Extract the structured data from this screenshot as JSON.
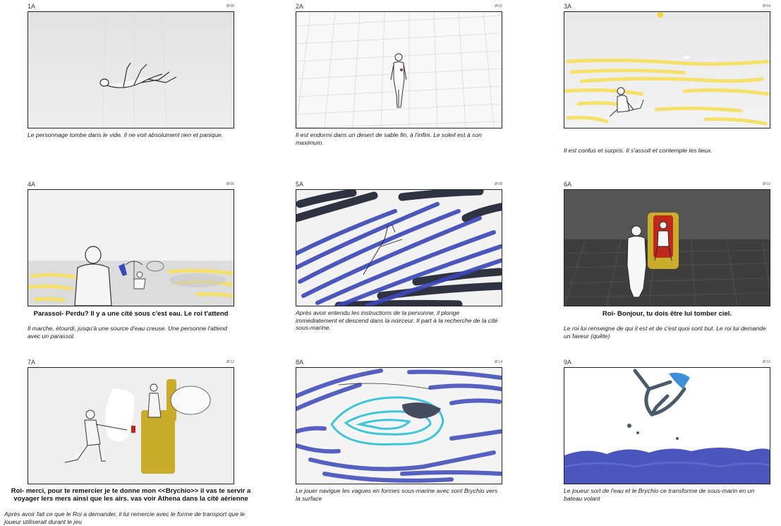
{
  "panels": [
    {
      "id": "1A",
      "time": "Ø:08",
      "dialogue": "",
      "caption": "Le personnage tombe dans le vide. Il ne voit absolument rien et panique."
    },
    {
      "id": "2A",
      "time": "Ø:02",
      "dialogue": "",
      "caption": "Il est endormi dans un desert de sable fin, à l'infini. Le soleil est à son maximum."
    },
    {
      "id": "3A",
      "time": "Ø:04",
      "dialogue": "",
      "caption": "Il est confus et surpris. Il s'assoit et contemple les lieux."
    },
    {
      "id": "4A",
      "time": "Ø:06",
      "dialogue": "Parassol- Perdu? Il y a une cité sous c'est eau. Le roi t'attend",
      "caption": "Il marche, étourdi, jusqu'à une source d'eau creuse. Une personne l'attend avec un parassol."
    },
    {
      "id": "5A",
      "time": "Ø:08",
      "dialogue": "",
      "caption": "Après avoir entendu les instructions de la personne, il plonge immédiatement et descend dans la noirceur. Il part à la recherche de la cité sous-marine."
    },
    {
      "id": "6A",
      "time": "Ø:10",
      "dialogue": "Roi- Bonjour, tu dois être lui tomber ciel.",
      "caption": "Le roi lui renseigne de qui il est et de c'est quoi sont but. Le roi lui demande un faveur (quête)"
    },
    {
      "id": "7A",
      "time": "Ø:12",
      "dialogue": "Roi- merci, pour te remercier je te donne mon <<Brychio>> il vas te servir a voyager lers mers ainsi que les airs. vas voir Athena dans la cité aérienne",
      "caption": "Après avoir fait ce que le Roi a demander, il lui remercie avec le forme de transport que le joueur utiliserait durant le jeu"
    },
    {
      "id": "8A",
      "time": "Ø:14",
      "dialogue": "",
      "caption": "Le jouer navigue les vagues en formes sous-marine avec sont Brychio vers la surface"
    },
    {
      "id": "9A",
      "time": "Ø:16",
      "dialogue": "",
      "caption": "Le joueur sort de l'eau et le Brychio ce transforme de sous-marin en un bateau volant"
    }
  ],
  "colors": {
    "yellow": "#f5e06a",
    "blue": "#3b47b8",
    "dark": "#1e2233",
    "cyan": "#3cc6d8",
    "red": "#c0281c",
    "gold": "#c9ad2a"
  }
}
